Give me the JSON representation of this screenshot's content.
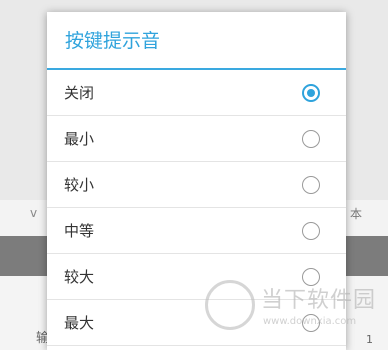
{
  "dialog": {
    "title": "按键提示音",
    "options": [
      {
        "label": "关闭",
        "selected": true
      },
      {
        "label": "最小",
        "selected": false
      },
      {
        "label": "较小",
        "selected": false
      },
      {
        "label": "中等",
        "selected": false
      },
      {
        "label": "较大",
        "selected": false
      },
      {
        "label": "最大",
        "selected": false
      }
    ]
  },
  "background": {
    "left_text": "v",
    "right_text": "本",
    "bottom_input_char": "输",
    "bottom_right_num": "1"
  },
  "watermark": {
    "name": "当下软件园",
    "url": "www.downxia.com"
  },
  "colors": {
    "accent": "#2fa3dc",
    "dim_bar": "#7c7c7c"
  }
}
